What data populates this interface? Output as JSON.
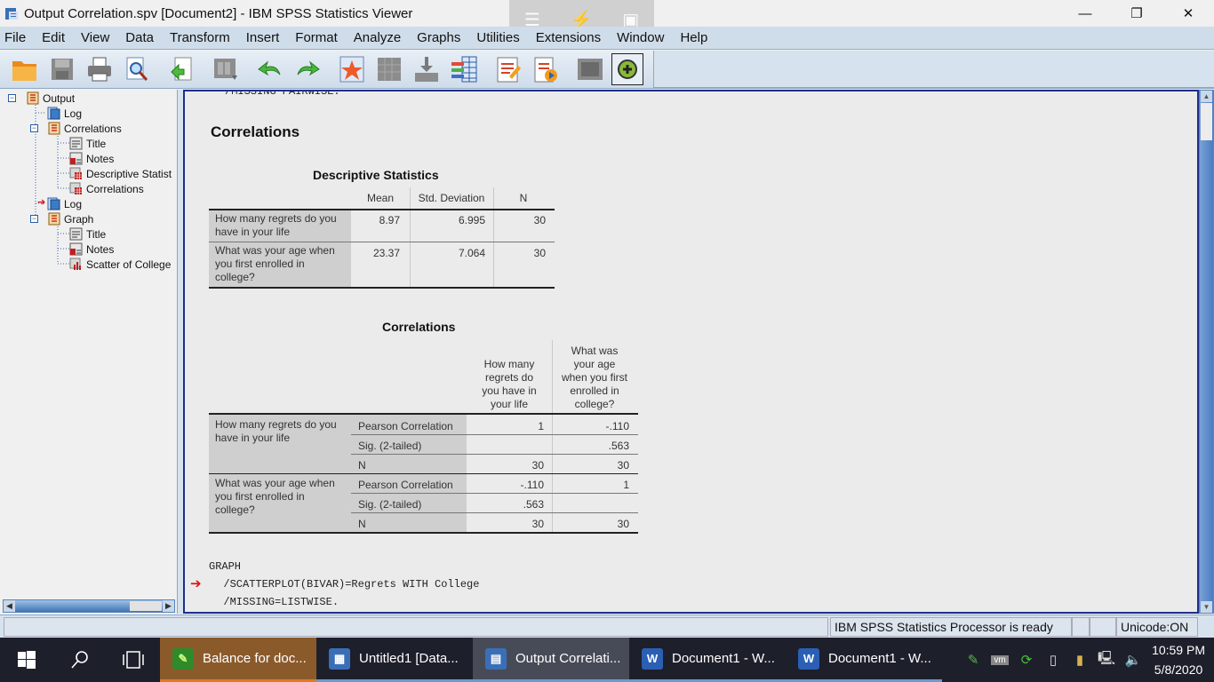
{
  "window": {
    "title": "Output Correlation.spv [Document2] - IBM SPSS Statistics Viewer",
    "controls": [
      "minimize",
      "restore",
      "close"
    ]
  },
  "overlay_tools": [
    "menu-icon",
    "unpin-icon",
    "switch-icon"
  ],
  "menubar": {
    "items": [
      "File",
      "Edit",
      "View",
      "Data",
      "Transform",
      "Insert",
      "Format",
      "Analyze",
      "Graphs",
      "Utilities",
      "Extensions",
      "Window",
      "Help"
    ]
  },
  "toolbar": {
    "buttons": [
      "open-icon",
      "save-icon",
      "print-icon",
      "print-preview-icon",
      "export-icon",
      "recall-dialog-icon",
      "undo-icon",
      "redo-icon",
      "goto-data-icon",
      "goto-case-icon",
      "goto-variable-icon",
      "variables-icon",
      "insert-output-icon",
      "run-script-icon",
      "designate-window-icon",
      "add-icon"
    ]
  },
  "outline": {
    "items": [
      {
        "label": "Output",
        "level": 0,
        "icon": "output-book-icon",
        "expanded": true
      },
      {
        "label": "Log",
        "level": 1,
        "icon": "log-icon"
      },
      {
        "label": "Correlations",
        "level": 1,
        "icon": "output-book-icon",
        "expanded": true
      },
      {
        "label": "Title",
        "level": 2,
        "icon": "title-icon"
      },
      {
        "label": "Notes",
        "level": 2,
        "icon": "notes-icon"
      },
      {
        "label": "Descriptive Statist",
        "level": 2,
        "icon": "table-icon"
      },
      {
        "label": "Correlations",
        "level": 2,
        "icon": "table-icon"
      },
      {
        "label": "Log",
        "level": 1,
        "icon": "log-icon",
        "current": true
      },
      {
        "label": "Graph",
        "level": 1,
        "icon": "output-book-icon",
        "expanded": true
      },
      {
        "label": "Title",
        "level": 2,
        "icon": "title-icon"
      },
      {
        "label": "Notes",
        "level": 2,
        "icon": "notes-icon"
      },
      {
        "label": "Scatter of College",
        "level": 2,
        "icon": "chart-icon"
      }
    ]
  },
  "content": {
    "top_syntax_cut": "/MISSING PAIRWISE.",
    "section_title": "Correlations",
    "descriptive": {
      "title": "Descriptive Statistics",
      "headers": [
        "Mean",
        "Std. Deviation",
        "N"
      ],
      "rows": [
        {
          "label": "How many regrets do you have in your life",
          "label_lines": [
            "How many regrets do you",
            "have in your life"
          ],
          "values": [
            "8.97",
            "6.995",
            "30"
          ]
        },
        {
          "label": "What was your age when you first enrolled in college?",
          "label_lines": [
            "What was your age when",
            "you first enrolled in",
            "college?"
          ],
          "values": [
            "23.37",
            "7.064",
            "30"
          ]
        }
      ]
    },
    "correlations": {
      "title": "Correlations",
      "col_headers": [
        {
          "lines": [
            "How many",
            "regrets do",
            "you have in",
            "your life"
          ]
        },
        {
          "lines": [
            "What was",
            "your age",
            "when you first",
            "enrolled in",
            "college?"
          ]
        }
      ],
      "groups": [
        {
          "label_lines": [
            "How many regrets do you",
            "have in your life"
          ],
          "rows": [
            {
              "stat": "Pearson Correlation",
              "values": [
                "1",
                "-.110"
              ]
            },
            {
              "stat": "Sig. (2-tailed)",
              "values": [
                "",
                ".563"
              ]
            },
            {
              "stat": "N",
              "values": [
                "30",
                "30"
              ]
            }
          ]
        },
        {
          "label_lines": [
            "What was your age when",
            "you first enrolled in",
            "college?"
          ],
          "rows": [
            {
              "stat": "Pearson Correlation",
              "values": [
                "-.110",
                "1"
              ]
            },
            {
              "stat": "Sig. (2-tailed)",
              "values": [
                ".563",
                ""
              ]
            },
            {
              "stat": "N",
              "values": [
                "30",
                "30"
              ]
            }
          ]
        }
      ]
    },
    "syntax": [
      "GRAPH",
      "  /SCATTERPLOT(BIVAR)=Regrets WITH College",
      "  /MISSING=LISTWISE."
    ]
  },
  "statusbar": {
    "message": "IBM SPSS Statistics Processor is ready",
    "unicode": "Unicode:ON"
  },
  "taskbar": {
    "apps": [
      {
        "label": "Balance for doc...",
        "icon": "balance-app-icon",
        "active": false,
        "highlight": "#8b5a2b"
      },
      {
        "label": "Untitled1 [Data...",
        "icon": "spss-data-icon",
        "active": false
      },
      {
        "label": "Output Correlati...",
        "icon": "spss-output-icon",
        "active": true
      },
      {
        "label": "Document1 - W...",
        "icon": "word-icon",
        "active": false
      },
      {
        "label": "Document1 - W...",
        "icon": "word-icon",
        "active": false
      }
    ],
    "tray": [
      "balance-tray-icon",
      "vmware-icon",
      "sync-icon",
      "usb-icon",
      "security-icon",
      "network-icon",
      "volume-icon"
    ],
    "time": "10:59 PM",
    "date": "5/8/2020"
  }
}
